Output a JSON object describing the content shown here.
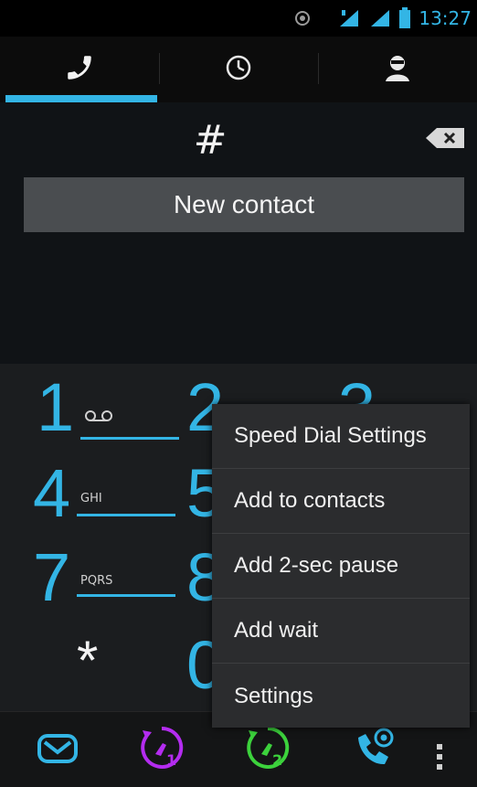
{
  "status_bar": {
    "time": "13:27",
    "icons": [
      "sync-icon",
      "signal-1-icon",
      "signal-2-icon",
      "battery-icon"
    ]
  },
  "tabs": [
    {
      "name": "dialer",
      "icon": "phone-icon",
      "active": true
    },
    {
      "name": "call-log",
      "icon": "clock-icon",
      "active": false
    },
    {
      "name": "contacts",
      "icon": "person-icon",
      "active": false
    }
  ],
  "dial_input": {
    "value": "#"
  },
  "new_contact": {
    "label": "New contact"
  },
  "dialpad": {
    "keys": [
      {
        "digit": "1",
        "letters": "",
        "icon": "voicemail-icon"
      },
      {
        "digit": "2",
        "letters": ""
      },
      {
        "digit": "3",
        "letters": ""
      },
      {
        "digit": "4",
        "letters": "GHI"
      },
      {
        "digit": "5",
        "letters": ""
      },
      {
        "digit": "7",
        "letters": "PQRS"
      },
      {
        "digit": "8",
        "letters": ""
      },
      {
        "digit": "*",
        "letters": ""
      },
      {
        "digit": "0",
        "letters": ""
      }
    ]
  },
  "menu": {
    "items": [
      "Speed Dial Settings",
      "Add to contacts",
      "Add 2-sec pause",
      "Add wait",
      "Settings"
    ]
  },
  "bottom_bar": {
    "buttons": [
      "message-icon",
      "call-sim1-icon",
      "call-sim2-icon",
      "video-call-icon",
      "overflow-menu-icon"
    ]
  },
  "colors": {
    "accent": "#33b5e5",
    "sim1": "#b42cf0",
    "sim2": "#3cd23c"
  }
}
